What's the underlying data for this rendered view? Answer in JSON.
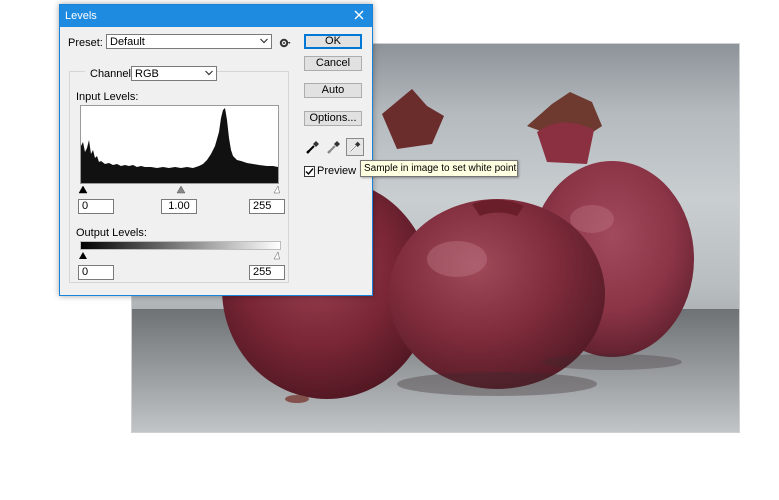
{
  "dialog": {
    "title": "Levels",
    "preset_label": "Preset:",
    "preset_value": "Default",
    "channel_label": "Channel:",
    "channel_value": "RGB",
    "input_levels_label": "Input Levels:",
    "input_black": "0",
    "input_gamma": "1.00",
    "input_white": "255",
    "output_levels_label": "Output Levels:",
    "output_black": "0",
    "output_white": "255",
    "buttons": {
      "ok": "OK",
      "cancel": "Cancel",
      "auto": "Auto",
      "options": "Options..."
    },
    "preview_label": "Preview",
    "preview_checked": true
  },
  "tooltip": {
    "text": "Sample in image to set white point"
  },
  "icons": {
    "close": "close-icon",
    "gear": "gear-icon",
    "dropdown": "chevron-down-icon",
    "black_eyedropper": "black-point-eyedropper-icon",
    "gray_eyedropper": "gray-point-eyedropper-icon",
    "white_eyedropper": "white-point-eyedropper-icon"
  },
  "colors": {
    "titlebar": "#1e8ae0",
    "dialog_bg": "#f0f0f0",
    "tooltip_bg": "#ffffe1",
    "fruit": "#8a2a3c"
  }
}
